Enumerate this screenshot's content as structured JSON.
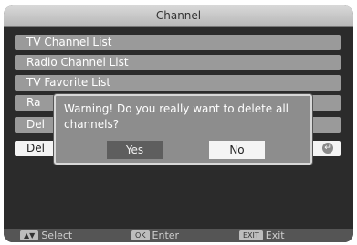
{
  "window": {
    "title": "Channel"
  },
  "menu": {
    "items": [
      {
        "label": "TV Channel List"
      },
      {
        "label": "Radio Channel List"
      },
      {
        "label": "TV Favorite List"
      },
      {
        "label": "Ra"
      },
      {
        "label": "Del"
      },
      {
        "label": "Del"
      }
    ],
    "selected_index": 5
  },
  "dialog": {
    "message": "Warning! Do you really want to delete all channels?",
    "yes_label": "Yes",
    "no_label": "No"
  },
  "footer": {
    "select": {
      "key": "▲▼",
      "label": "Select"
    },
    "enter": {
      "key": "OK",
      "label": "Enter"
    },
    "exit": {
      "key": "EXIT",
      "label": "Exit"
    }
  }
}
